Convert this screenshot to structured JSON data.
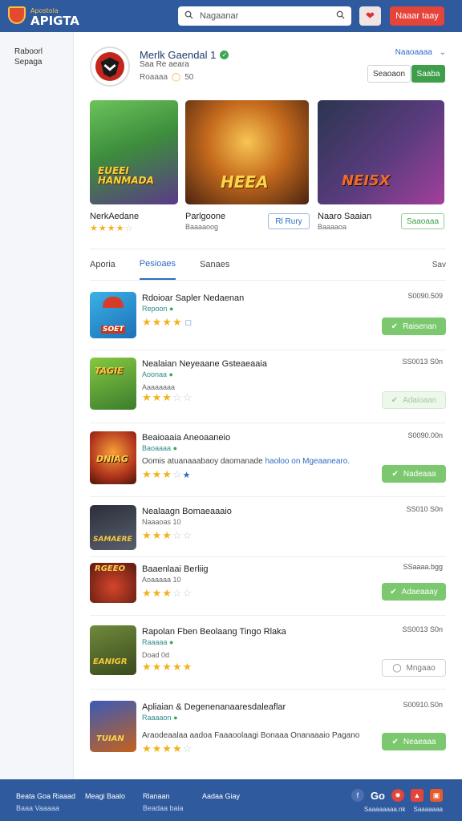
{
  "header": {
    "logo_tag": "Apostola",
    "logo_name": "APIGTA",
    "search_placeholder": "Nagaanar",
    "cta_label": "Naaar taay"
  },
  "sidebar": {
    "items": [
      "Raboorl",
      "Sepaga"
    ]
  },
  "developer": {
    "name": "Merlk Gaendal 1",
    "subtitle": "Saa Re aeara",
    "stat_label": "Roaaaa",
    "stat_value": "50",
    "link": "Naaoaaaa",
    "btn_outline": "Seaoaon",
    "btn_primary": "Saaba"
  },
  "featured": [
    {
      "title": "NerkAedane",
      "meta": "",
      "art": "EUEEI\nHANMADA",
      "button": ""
    },
    {
      "title": "Parlgoone",
      "meta": "Baaaaoog",
      "art": "HEEA",
      "button": "Rl Rury"
    },
    {
      "title": "Naaro Saaian",
      "meta": "Baaaaoa",
      "art": "NEI5X",
      "button": "Saaoaaa"
    }
  ],
  "tabs": {
    "items": [
      "Aporia",
      "Pesioaes",
      "Sanaes"
    ],
    "right": "Sav"
  },
  "items": [
    {
      "title": "Rdoioar Sapler Nedaenan",
      "sub": "Repoon",
      "desc": "",
      "desc_hl": "",
      "size": "S0090.509",
      "button": "Raisenan",
      "art": "SOET"
    },
    {
      "title": "Nealaian Neyeaane Gsteaeaaia",
      "sub": "Aoonaa",
      "desc": "Aaaaaaaa",
      "desc_hl": "",
      "size": "SS0013 S0n",
      "button": "Adaioaan",
      "art": "TAGIE"
    },
    {
      "title": "Beaioaaia Aneoaaneio",
      "sub": "Baoaaaa",
      "desc": "Oomis atuanaaabaoy daomanade",
      "desc_hl": "haoloo on Mgeaanearo.",
      "size": "S0090.00n",
      "button": "Nadeaaa",
      "art": "DNIAG"
    },
    {
      "title": "Nealaagn Bomaeaaaio",
      "sub": "Naaaoas 10",
      "desc": "",
      "desc_hl": "",
      "size": "SS010 S0n",
      "button": "",
      "art": "SAMAERE"
    },
    {
      "title": "Baaenlaai Berliig",
      "sub": "Aoaaaaa 10",
      "desc": "",
      "desc_hl": "",
      "size": "SSaaaa.bgg",
      "button": "Adaeaaay",
      "art": "RGEEO"
    },
    {
      "title": "Rapolan Fben Beolaang Tingo Rlaka",
      "sub": "Raaaaa",
      "desc": "Doad 0d",
      "desc_hl": "",
      "size": "SS0013 S0n",
      "button": "Mngaao",
      "art": "EANIGR"
    },
    {
      "title": "Apliaian & Degenenanaaresdaleaflar",
      "sub": "Raaaaon",
      "desc": "Araodeaalaa aadoa Faaaoolaagi Bonaaa Onanaaaio Pagano",
      "desc_hl": "",
      "size": "S00910.S0n",
      "button": "Neaeaaa",
      "art": "TUIAN"
    }
  ],
  "footer": {
    "col1": [
      "Beata Goa Riaaad",
      "Baaa Vaaaaa"
    ],
    "col2": [
      "Meagi Baalo"
    ],
    "col3": [
      "Rlanaan",
      "Beadaa baia"
    ],
    "col4": [
      "Aadaa Giay"
    ],
    "social_text": "Go",
    "bottom": [
      "Saaaaaaaa.nk",
      "Saaaaaaa"
    ]
  },
  "colors": {
    "brand": "#2f5a9e",
    "accent": "#e4443a",
    "success": "#7cc86f",
    "star": "#f2b21c"
  }
}
